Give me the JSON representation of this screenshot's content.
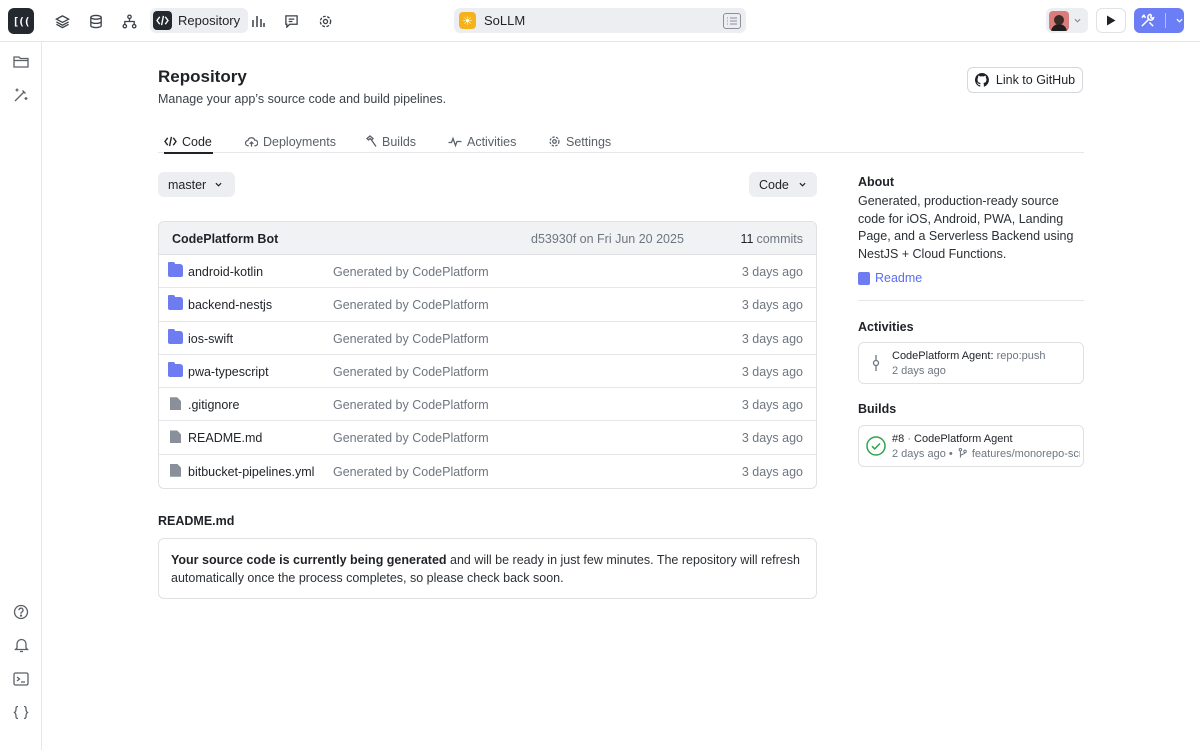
{
  "topbar": {
    "logo_text": "[((",
    "active_section": "Repository",
    "project_name": "SoLLM",
    "icons": [
      "layers-icon",
      "database-icon",
      "hierarchy-icon",
      "code-icon",
      "bar-chart-icon",
      "chat-icon",
      "gear-icon"
    ]
  },
  "page": {
    "title": "Repository",
    "subtitle": "Manage your app’s source code and build pipelines.",
    "github_button": "Link to GitHub"
  },
  "tabs": [
    {
      "label": "Code",
      "active": true
    },
    {
      "label": "Deployments"
    },
    {
      "label": "Builds"
    },
    {
      "label": "Activities"
    },
    {
      "label": "Settings"
    }
  ],
  "branch": "master",
  "code_button": "Code",
  "file_table": {
    "author": "CodePlatform Bot",
    "commit": "d53930f on Fri Jun 20 2025",
    "commit_count": "11",
    "commit_label": "commits",
    "rows": [
      {
        "type": "folder",
        "name": "android-kotlin",
        "message": "Generated by CodePlatform",
        "time": "3 days ago"
      },
      {
        "type": "folder",
        "name": "backend-nestjs",
        "message": "Generated by CodePlatform",
        "time": "3 days ago"
      },
      {
        "type": "folder",
        "name": "ios-swift",
        "message": "Generated by CodePlatform",
        "time": "3 days ago"
      },
      {
        "type": "folder",
        "name": "pwa-typescript",
        "message": "Generated by CodePlatform",
        "time": "3 days ago"
      },
      {
        "type": "file",
        "name": ".gitignore",
        "message": "Generated by CodePlatform",
        "time": "3 days ago"
      },
      {
        "type": "file",
        "name": "README.md",
        "message": "Generated by CodePlatform",
        "time": "3 days ago"
      },
      {
        "type": "file",
        "name": "bitbucket-pipelines.yml",
        "message": "Generated by CodePlatform",
        "time": "3 days ago"
      }
    ]
  },
  "readme": {
    "title": "README.md",
    "bold_text": "Your source code is currently being generated",
    "text": " and will be ready in just few minutes. The repository will refresh automatically once the process completes, so please check back soon."
  },
  "about": {
    "heading": "About",
    "description": "Generated, production-ready source code for iOS, Android, PWA, Landing Page, and a Serverless Backend using NestJS + Cloud Functions.",
    "readme_link": "Readme"
  },
  "activities": {
    "heading": "Activities",
    "item": {
      "actor": "CodePlatform Agent:",
      "action": "repo:push",
      "time": "2 days ago"
    }
  },
  "builds": {
    "heading": "Builds",
    "item": {
      "number": "#8",
      "sep": "·",
      "agent": "CodePlatform Agent",
      "time": "2 days ago •",
      "branch": "features/monorepo-scri…"
    }
  },
  "colors": {
    "accent": "#6b7ef5",
    "folder": "#6d7cf0",
    "success": "#2da44e"
  }
}
